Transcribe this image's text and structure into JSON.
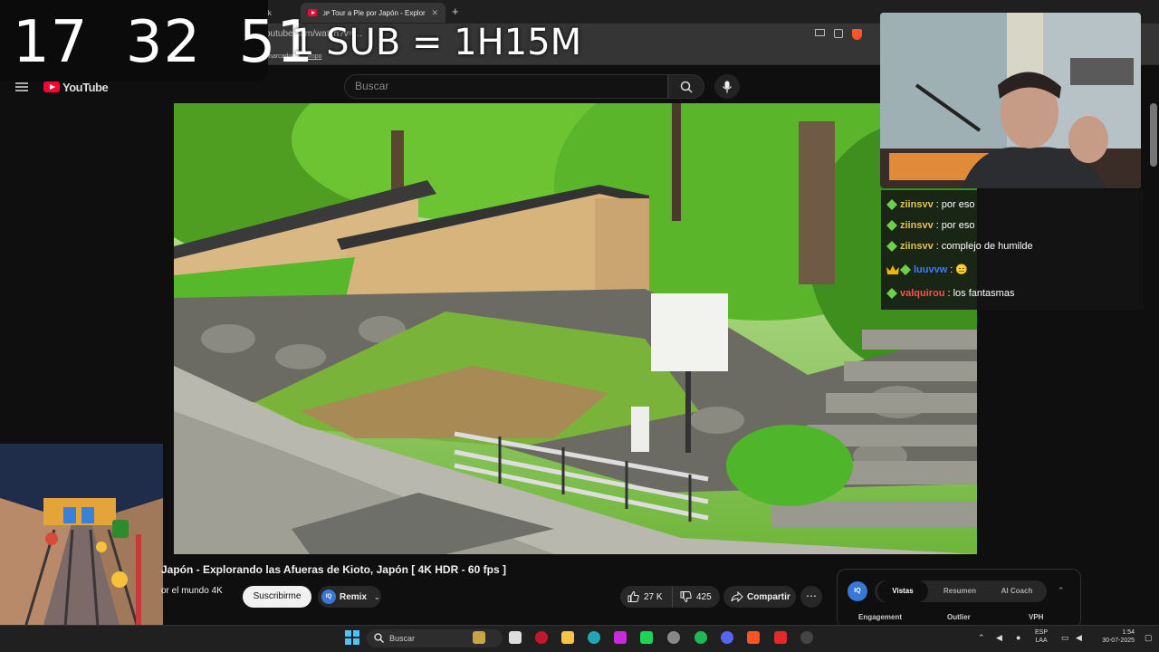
{
  "browser": {
    "tabs": [
      {
        "label": "n Kick"
      },
      {
        "label": "ᴊᴘ Tour a Pie por Japón - Explora"
      }
    ],
    "new_tab": "+",
    "url": "youtube.com/watch?v=…",
    "bookmarks": [
      "marcadores",
      "Impo"
    ]
  },
  "youtube": {
    "logo_text": "YouTube",
    "search_placeholder": "Buscar"
  },
  "overlay": {
    "clock": "17 32 51",
    "sub_goal": "1 SUB = 1H15M"
  },
  "chat": [
    {
      "user": "ziinsvv",
      "message": "por eso",
      "user_color": "#e3c44d"
    },
    {
      "user": "ziinsvv",
      "message": "por eso",
      "user_color": "#e3c44d"
    },
    {
      "user": "ziinsvv",
      "message": "complejo de humilde",
      "user_color": "#e3c44d"
    },
    {
      "user": "luuvvw",
      "message": "😑",
      "user_color": "#3b7bff"
    },
    {
      "user": "valquirou",
      "message": "los fantasmas",
      "user_color": "#ff4f4f"
    }
  ],
  "video": {
    "title": "Japón - Explorando las Afueras de Kioto, Japón [ 4K HDR - 60 fps ]",
    "channel": "or el mundo 4K",
    "subscribe": "Suscribirme",
    "remix": "Remix",
    "likes": "27 K",
    "dislikes": "425",
    "share": "Compartir",
    "more": "⋯"
  },
  "vidiq": {
    "logo": "IQ",
    "tabs": [
      "Vistas",
      "Resumen",
      "AI Coach"
    ],
    "active_tab": "Vistas",
    "columns": [
      "Engagement",
      "Outlier",
      "VPH"
    ]
  },
  "taskbar": {
    "search": "Buscar",
    "lang_top": "ESP",
    "lang_bottom": "LAA",
    "time": "1:54",
    "date": "30-07-2025"
  },
  "colors": {
    "accent": "#ff0033",
    "vidiq": "#3a77d6",
    "subscribe_bg": "#f1f1f1"
  }
}
